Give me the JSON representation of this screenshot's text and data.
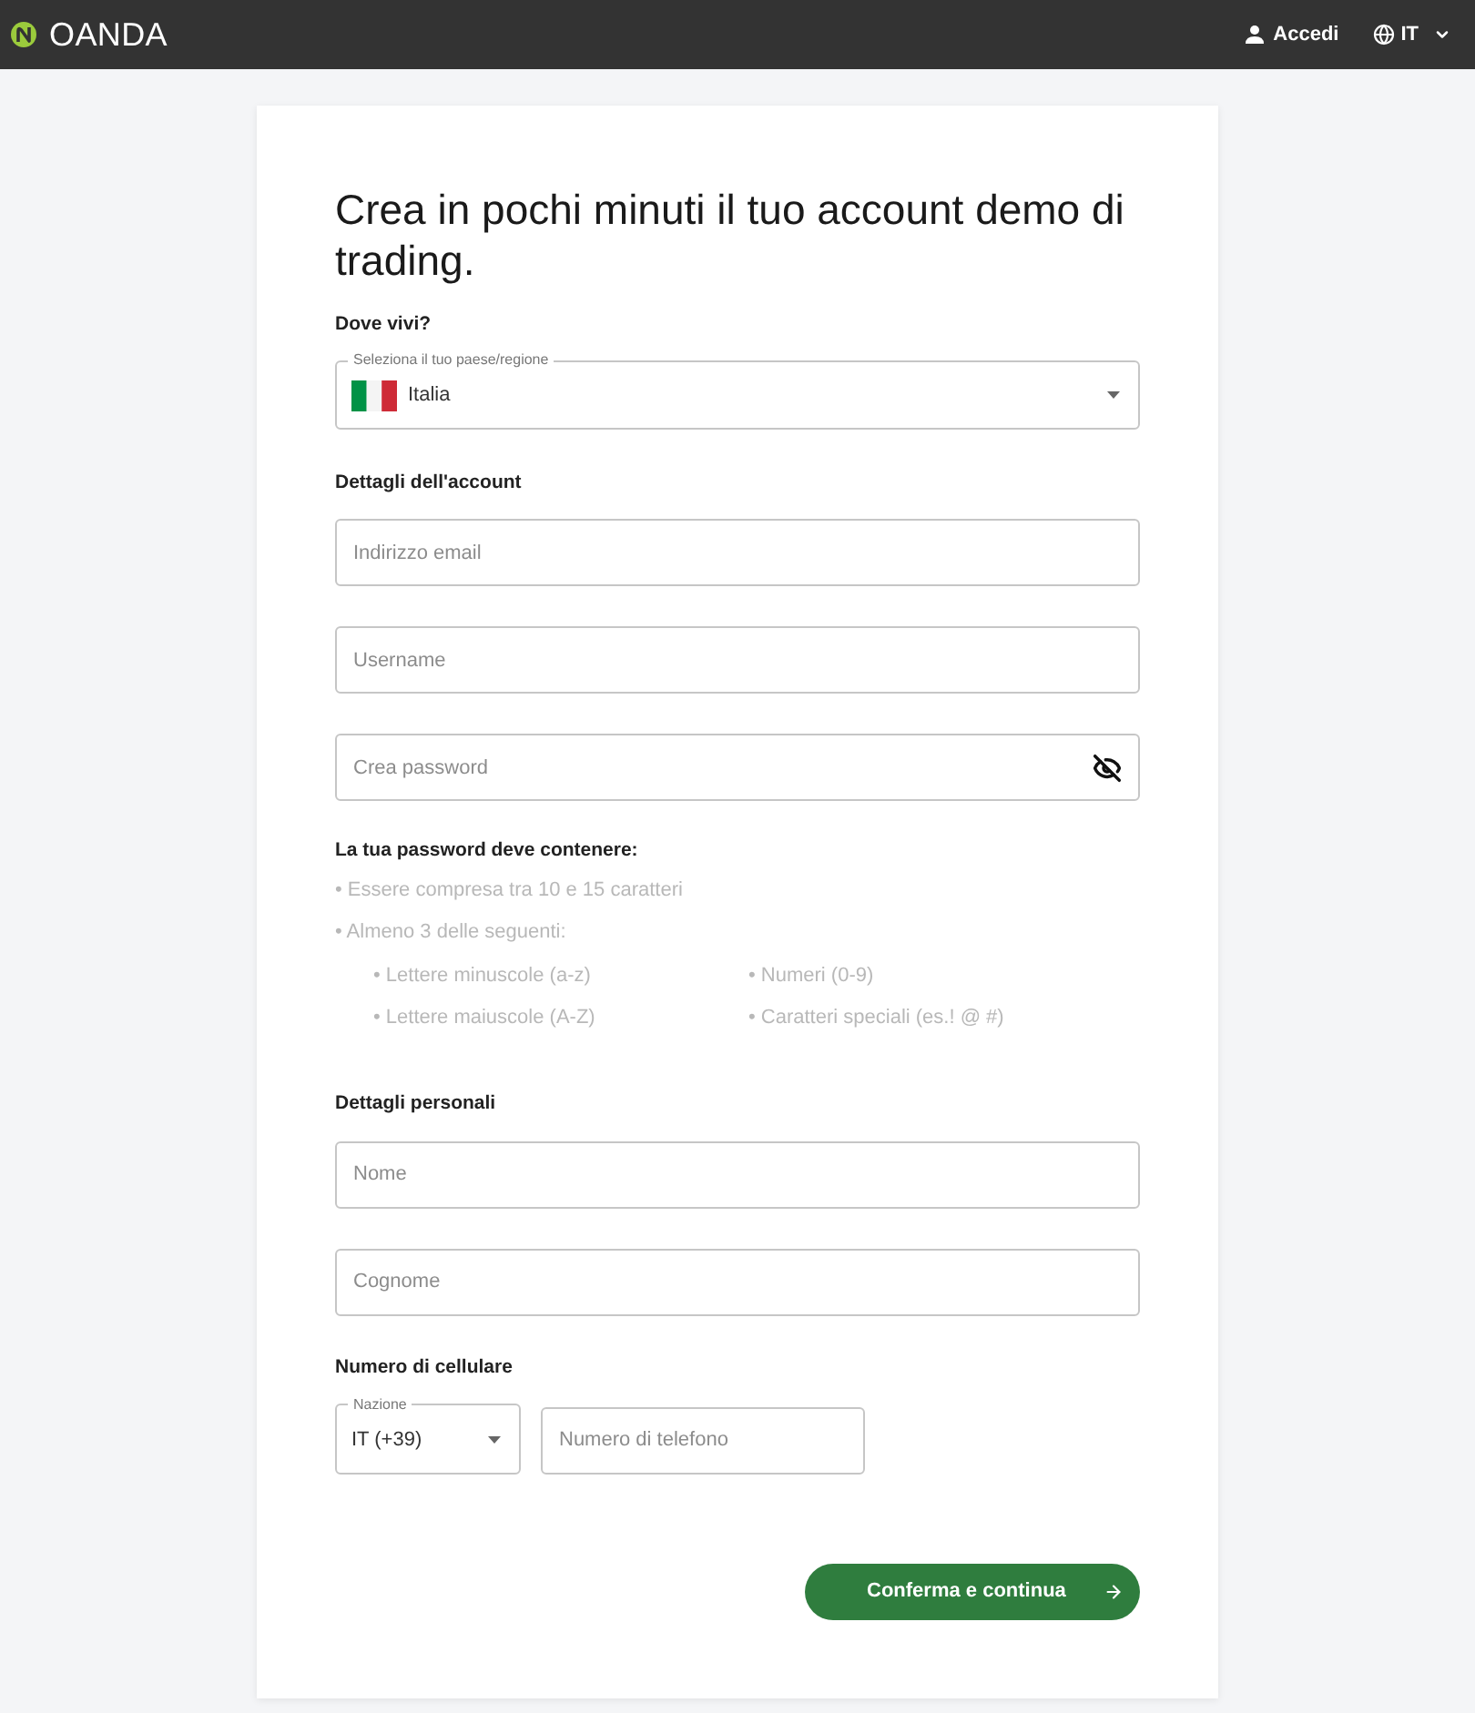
{
  "header": {
    "brand": "OANDA",
    "login": "Accedi",
    "language": "IT"
  },
  "form": {
    "title": "Crea in pochi minuti il tuo account demo di trading.",
    "residence": {
      "heading": "Dove vivi?",
      "label": "Seleziona il tuo paese/regione",
      "value": "Italia"
    },
    "account": {
      "heading": "Dettagli dell'account",
      "fields": [
        {
          "kind": "text",
          "placeholder": "Indirizzo email"
        },
        {
          "kind": "text",
          "placeholder": "Username"
        },
        {
          "kind": "password",
          "placeholder": "Crea password"
        }
      ]
    },
    "password_rules": {
      "heading": "La tua password deve contenere:",
      "items": [
        {
          "text": "• Essere compresa tra 10 e 15 caratteri"
        },
        {
          "text": "• Almeno 3 delle seguenti:",
          "children": [
            {
              "text": "• Lettere minuscole (a-z)"
            },
            {
              "text": "• Numeri (0-9)"
            },
            {
              "text": "• Lettere maiuscole (A-Z)"
            },
            {
              "text": "• Caratteri speciali (es.! @ #)"
            }
          ]
        }
      ]
    },
    "personal": {
      "heading": "Dettagli personali",
      "fields": [
        {
          "kind": "text",
          "placeholder": "Nome"
        },
        {
          "kind": "text",
          "placeholder": "Cognome"
        }
      ]
    },
    "mobile": {
      "heading": "Numero di cellulare",
      "country_label": "Nazione",
      "country_value": "IT (+39)",
      "placeholder": "Numero di telefono"
    },
    "submit": "Conferma e continua"
  }
}
